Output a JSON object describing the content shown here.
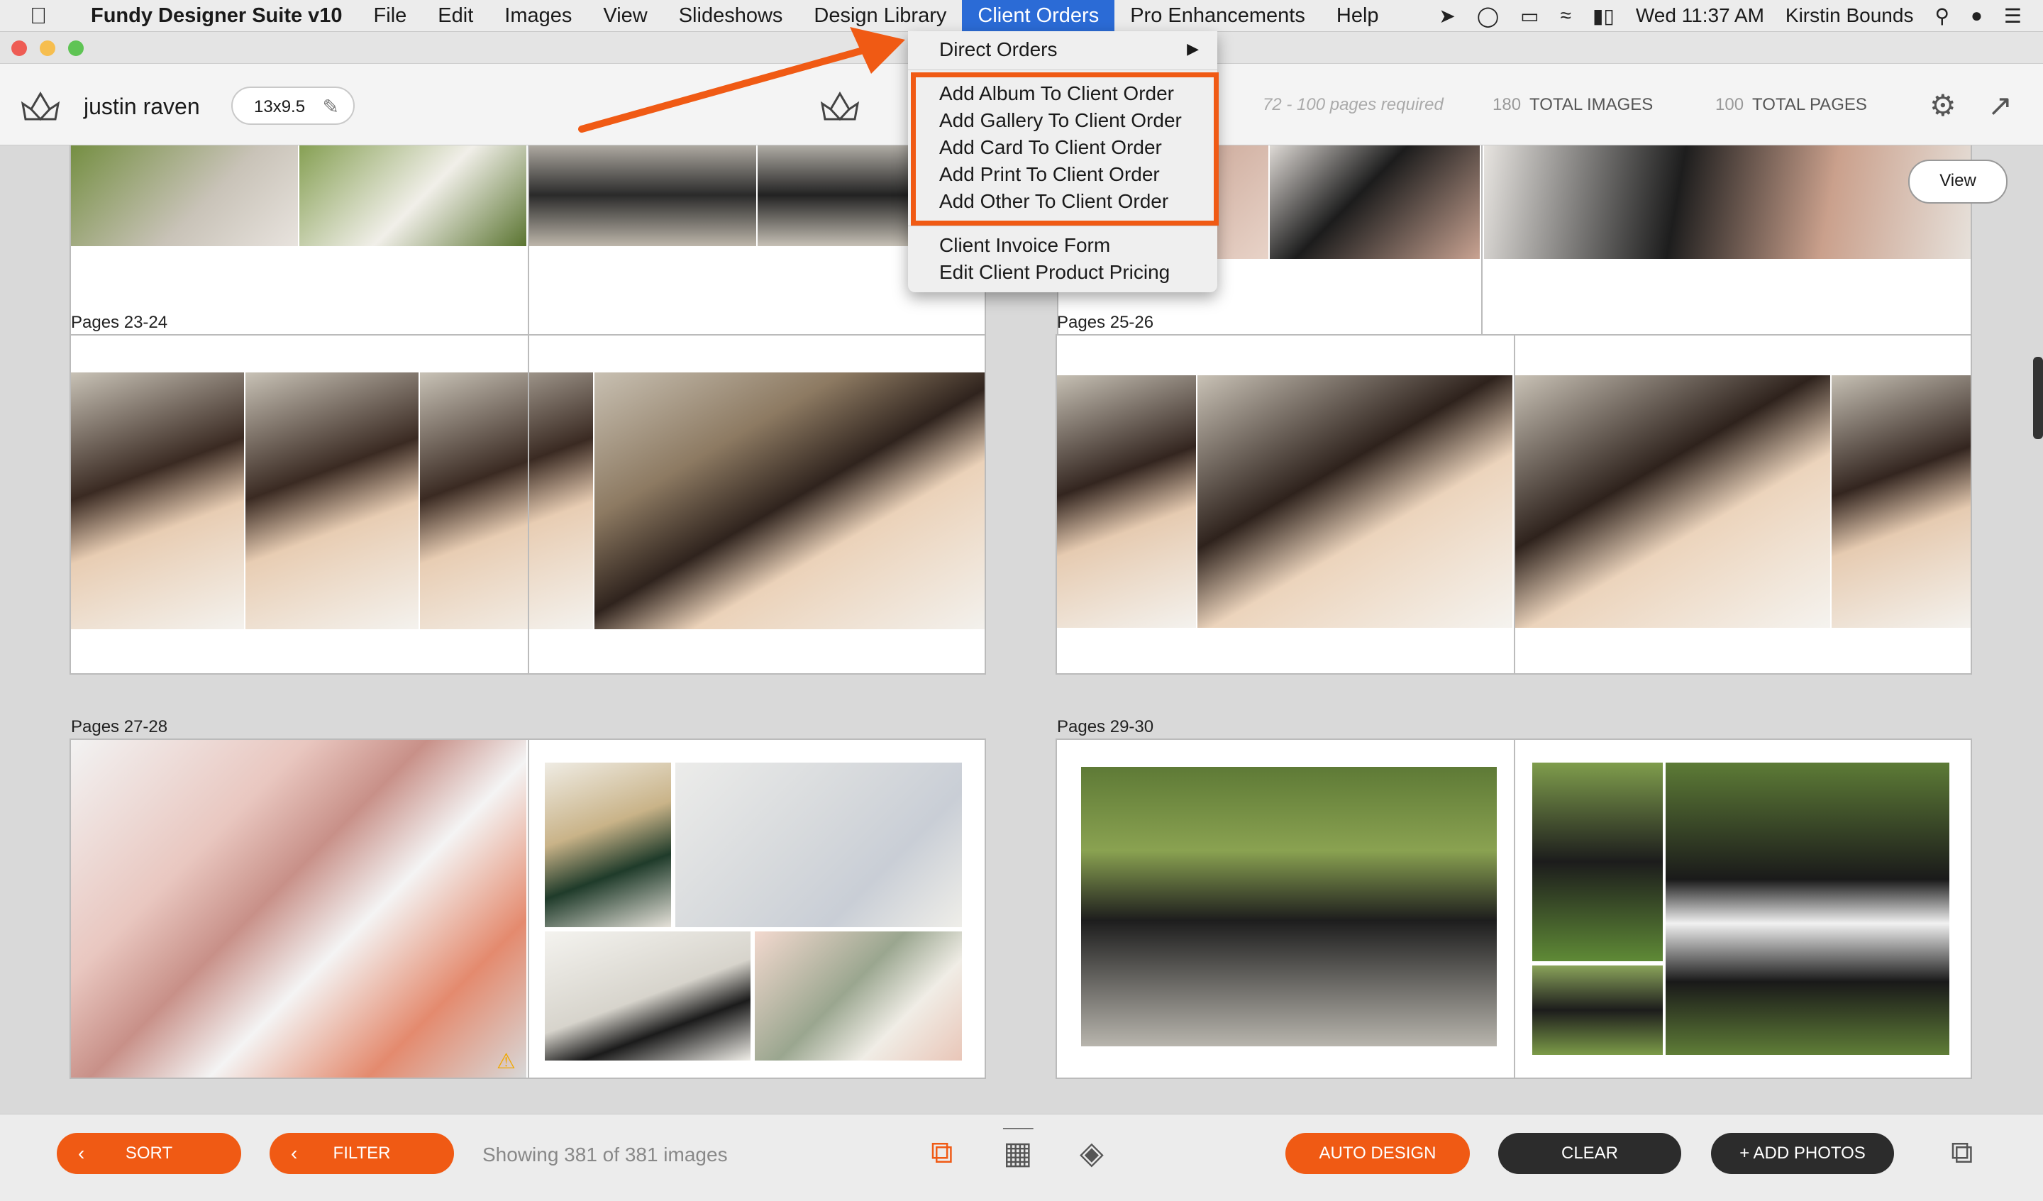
{
  "menubar": {
    "app_name": "Fundy Designer Suite v10",
    "items": [
      "File",
      "Edit",
      "Images",
      "View",
      "Slideshows",
      "Design Library",
      "Client Orders",
      "Pro Enhancements",
      "Help"
    ],
    "active_item": "Client Orders",
    "clock": "Wed 11:37 AM",
    "user": "Kirstin Bounds"
  },
  "toolbar": {
    "project_name": "justin raven",
    "album_size": "13x9.5",
    "pages_required": "72 - 100 pages required",
    "total_images_value": "180",
    "total_images_label": "TOTAL IMAGES",
    "total_pages_value": "100",
    "total_pages_label": "TOTAL PAGES"
  },
  "dropdown": {
    "direct_orders": "Direct Orders",
    "add_items": [
      "Add Album To Client Order",
      "Add Gallery To Client Order",
      "Add Card To Client Order",
      "Add Print To Client Order",
      "Add Other To Client Order"
    ],
    "client_invoice_form": "Client Invoice Form",
    "edit_pricing": "Edit Client Product Pricing"
  },
  "content": {
    "view_button": "View",
    "spreads": [
      {
        "label": "Pages 23-24"
      },
      {
        "label": "Pages 25-26"
      },
      {
        "label": "Pages 27-28"
      },
      {
        "label": "Pages 29-30"
      }
    ]
  },
  "bottombar": {
    "sort": "SORT",
    "filter": "FILTER",
    "showing": "Showing 381 of 381 images",
    "auto_design": "AUTO DESIGN",
    "clear": "CLEAR",
    "add_photos": "+ ADD PHOTOS"
  },
  "colors": {
    "accent_orange": "#f05a14",
    "menu_highlight_blue": "#2b6bd6",
    "dark_button": "#2c2c2c"
  },
  "icons": [
    "apple-icon",
    "fundy-logo-icon",
    "pencil-icon",
    "settings-gear-icon",
    "export-icon",
    "warning-icon",
    "stack-icon",
    "grid-icon",
    "layers-icon",
    "fullscreen-icon",
    "wifi-icon",
    "battery-icon",
    "search-icon"
  ]
}
